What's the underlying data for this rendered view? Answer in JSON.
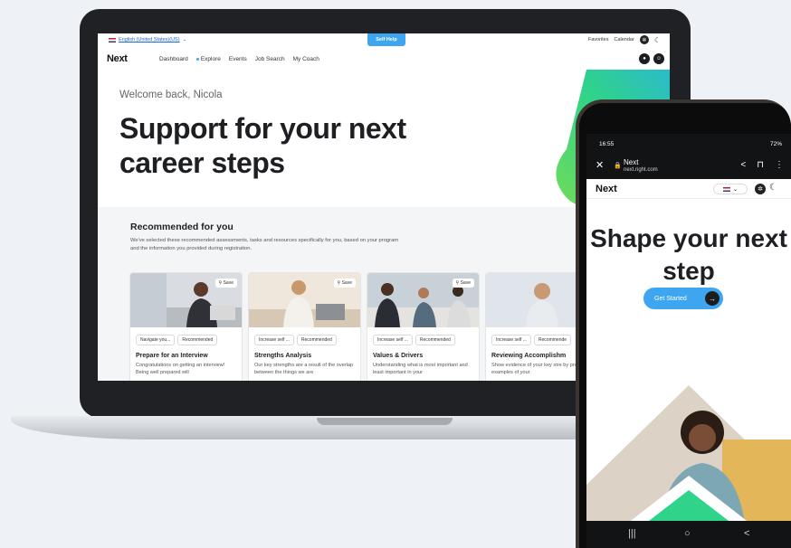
{
  "laptop": {
    "topbar": {
      "language": "English (United States)(US)",
      "self_help": "Self Help",
      "favorites": "Favorites",
      "calendar": "Calendar"
    },
    "nav": {
      "logo": "Next",
      "links": [
        "Dashboard",
        "Explore",
        "Events",
        "Job Search",
        "My Coach"
      ]
    },
    "hero": {
      "welcome": "Welcome back, Nicola",
      "headline": "Support for your next career steps"
    },
    "recommended": {
      "title": "Recommended for you",
      "description": "We've selected these recommended assessments, tasks and resources specifically for you, based on your program and the information you provided during registration.",
      "save_label": "Save",
      "cards": [
        {
          "tag1": "Navigate you...",
          "tag2": "Recommended",
          "title": "Prepare for an Interview",
          "text": "Congratulations on getting an interview! Being well prepared will"
        },
        {
          "tag1": "Increase self ...",
          "tag2": "Recommended",
          "title": "Strengths Analysis",
          "text": "Our key strengths are a result of the overlap between the things we are"
        },
        {
          "tag1": "Increase self ...",
          "tag2": "Recommended",
          "title": "Values & Drivers",
          "text": "Understanding what is most important and least important in your"
        },
        {
          "tag1": "Increase self ...",
          "tag2": "Recommende",
          "title": "Reviewing Accomplishm",
          "text": "Show evidence of your key stre by providing examples of your"
        }
      ]
    }
  },
  "phone": {
    "status": {
      "time": "16:55",
      "battery": "72%"
    },
    "browser": {
      "site": "Next",
      "url": "next.right.com"
    },
    "nav": {
      "logo": "Next"
    },
    "hero": {
      "headline": "Shape your next step",
      "cta": "Get Started"
    }
  },
  "colors": {
    "accent": "#3ea6f0",
    "green": "#2fd38a",
    "dark": "#1b1d21"
  }
}
